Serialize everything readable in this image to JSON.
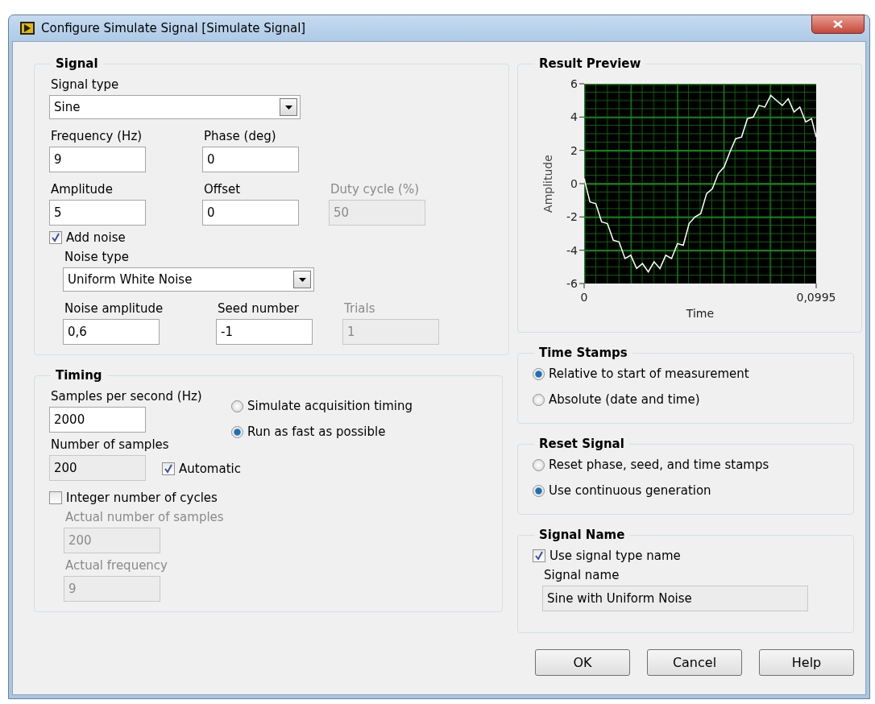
{
  "window": {
    "title": "Configure Simulate Signal [Simulate Signal]"
  },
  "signal": {
    "title": "Signal",
    "signal_type": {
      "label": "Signal type",
      "value": "Sine"
    },
    "rows": [
      [
        {
          "label": "Frequency (Hz)",
          "value": "9",
          "disabled": false,
          "read_only": false
        },
        {
          "label": "Phase (deg)",
          "value": "0",
          "disabled": false,
          "read_only": false
        }
      ],
      [
        {
          "label": "Amplitude",
          "value": "5",
          "disabled": false,
          "read_only": false
        },
        {
          "label": "Offset",
          "value": "0",
          "disabled": false,
          "read_only": false
        },
        {
          "label": "Duty cycle (%)",
          "value": "50",
          "disabled": true,
          "read_only": true
        }
      ]
    ],
    "add_noise": {
      "label": "Add noise",
      "checked": true
    },
    "noise_type": {
      "label": "Noise type",
      "value": "Uniform White Noise"
    },
    "noise_fields": [
      {
        "label": "Noise amplitude",
        "value": "0,6",
        "disabled": false,
        "read_only": false
      },
      {
        "label": "Seed number",
        "value": "-1",
        "disabled": false,
        "read_only": false
      },
      {
        "label": "Trials",
        "value": "1",
        "disabled": true,
        "read_only": true
      }
    ]
  },
  "timing": {
    "title": "Timing",
    "samples_per_second": {
      "label": "Samples per second (Hz)",
      "value": "2000",
      "disabled": false,
      "read_only": false
    },
    "number_of_samples": {
      "label": "Number of samples",
      "value": "200",
      "disabled": false,
      "read_only": true
    },
    "automatic": {
      "label": "Automatic",
      "checked": true
    },
    "timing_mode": [
      {
        "label": "Simulate acquisition timing",
        "selected": false
      },
      {
        "label": "Run as fast as possible",
        "selected": true
      }
    ],
    "integer_cycles": {
      "label": "Integer number of cycles",
      "checked": false
    },
    "actual_fields": [
      {
        "label": "Actual number of samples",
        "value": "200",
        "disabled": true,
        "read_only": true
      },
      {
        "label": "Actual frequency",
        "value": "9",
        "disabled": true,
        "read_only": true
      }
    ]
  },
  "result_preview": {
    "title": "Result Preview",
    "chart_data": {
      "type": "line",
      "xlabel": "Time",
      "ylabel": "Amplitude",
      "xlim": [
        0,
        0.0995
      ],
      "ylim": [
        -6,
        6
      ],
      "xticks": [
        0,
        {
          "value": 0.0995,
          "label": "0,0995"
        }
      ],
      "yticks": [
        -6,
        -4,
        -2,
        0,
        2,
        4,
        6
      ],
      "x": [
        0,
        0.0025,
        0.005,
        0.0075,
        0.01,
        0.0125,
        0.015,
        0.0175,
        0.02,
        0.0225,
        0.025,
        0.0275,
        0.03,
        0.0325,
        0.035,
        0.0375,
        0.04,
        0.0425,
        0.045,
        0.0475,
        0.05,
        0.0525,
        0.055,
        0.0575,
        0.06,
        0.0625,
        0.065,
        0.0675,
        0.07,
        0.0725,
        0.075,
        0.0775,
        0.08,
        0.0825,
        0.085,
        0.0875,
        0.09,
        0.0925,
        0.095,
        0.0975,
        0.0995
      ],
      "grid": true,
      "series": [
        {
          "color": "#ffffff",
          "values": [
            0.3,
            -1.1,
            -1.2,
            -2.3,
            -2.4,
            -3.4,
            -3.5,
            -4.5,
            -4.3,
            -5.1,
            -4.8,
            -5.3,
            -4.7,
            -5.1,
            -4.3,
            -4.5,
            -3.6,
            -3.7,
            -2.4,
            -2.0,
            -1.8,
            -0.6,
            -0.3,
            0.6,
            1.0,
            1.9,
            2.7,
            2.8,
            3.9,
            4.0,
            4.7,
            4.6,
            5.3,
            5.0,
            4.7,
            5.1,
            4.3,
            4.6,
            3.7,
            3.9,
            2.8
          ]
        }
      ]
    }
  },
  "time_stamps": {
    "title": "Time Stamps",
    "options": [
      {
        "label": "Relative to start of measurement",
        "selected": true
      },
      {
        "label": "Absolute (date and time)",
        "selected": false
      }
    ]
  },
  "reset_signal": {
    "title": "Reset Signal",
    "options": [
      {
        "label": "Reset phase, seed, and time stamps",
        "selected": false
      },
      {
        "label": "Use continuous generation",
        "selected": true
      }
    ]
  },
  "signal_name": {
    "title": "Signal Name",
    "use_type_name": {
      "label": "Use signal type name",
      "checked": true
    },
    "name_field": {
      "label": "Signal name",
      "value": "Sine with Uniform Noise",
      "disabled": false,
      "read_only": true
    }
  },
  "buttons": [
    "OK",
    "Cancel",
    "Help"
  ]
}
